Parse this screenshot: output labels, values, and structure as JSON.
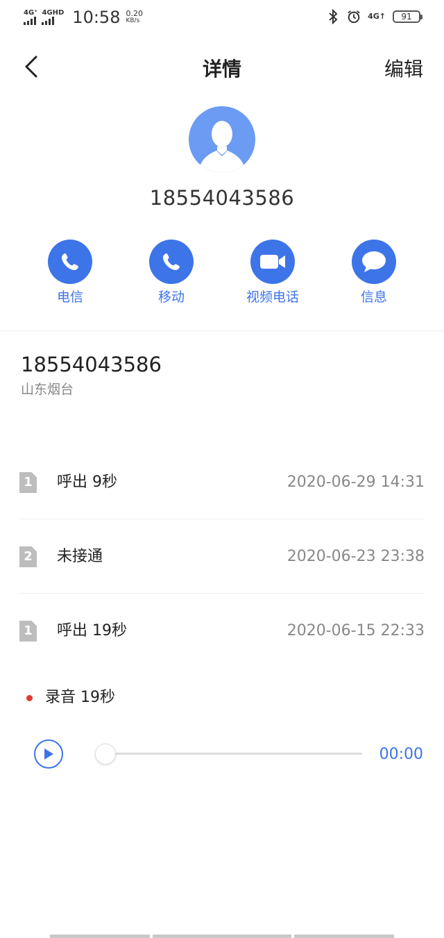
{
  "status_bar": {
    "net1": "4G⁺",
    "net2": "4GHD",
    "time": "10:58",
    "speed_value": "0.20",
    "speed_unit": "KB/s",
    "net3": "4G↑",
    "battery": "91"
  },
  "header": {
    "title": "详情",
    "edit_label": "编辑"
  },
  "contact": {
    "number": "18554043586"
  },
  "actions": [
    {
      "label": "电信",
      "icon": "phone-icon"
    },
    {
      "label": "移动",
      "icon": "phone-icon"
    },
    {
      "label": "视频电话",
      "icon": "video-camera-icon"
    },
    {
      "label": "信息",
      "icon": "message-bubble-icon"
    }
  ],
  "detail": {
    "number": "18554043586",
    "location": "山东烟台"
  },
  "call_log": [
    {
      "sim": "1",
      "type": "呼出 9秒",
      "time": "2020-06-29 14:31"
    },
    {
      "sim": "2",
      "type": "未接通",
      "time": "2020-06-23 23:38"
    },
    {
      "sim": "1",
      "type": "呼出 19秒",
      "time": "2020-06-15 22:33"
    }
  ],
  "recording": {
    "label": "录音 19秒",
    "position": "00:00",
    "progress": 0
  },
  "colors": {
    "accent": "#3d74e8",
    "avatar": "#6b9bf2",
    "record_dot": "#e53935"
  }
}
